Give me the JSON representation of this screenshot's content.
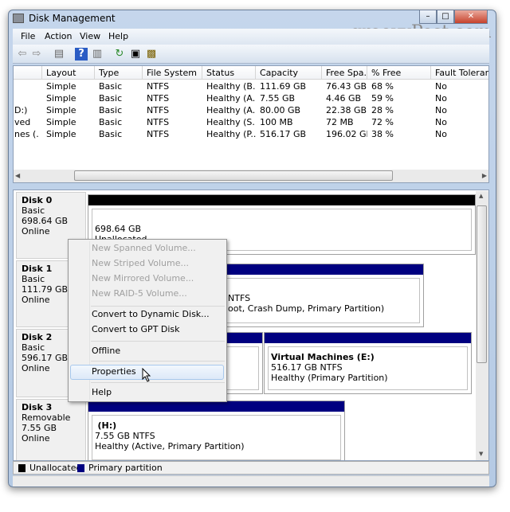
{
  "window": {
    "title": "Disk Management",
    "watermark": "groovyPost.com"
  },
  "menu": [
    "File",
    "Action",
    "View",
    "Help"
  ],
  "toolbar": [
    "back-icon",
    "forward-icon",
    "show-hide-console-tree-icon",
    "help-icon",
    "show-hide-action-pane-icon",
    "refresh-icon",
    "properties-icon",
    "rescan-icon"
  ],
  "columns": [
    "",
    "Layout",
    "Type",
    "File System",
    "Status",
    "Capacity",
    "Free Spa...",
    "% Free",
    "Fault Toleranc"
  ],
  "rows": [
    [
      "",
      "Simple",
      "Basic",
      "NTFS",
      "Healthy (B...",
      "111.69 GB",
      "76.43 GB",
      "68 %",
      "No"
    ],
    [
      "",
      "Simple",
      "Basic",
      "NTFS",
      "Healthy (A...",
      "7.55 GB",
      "4.46 GB",
      "59 %",
      "No"
    ],
    [
      "D:)",
      "Simple",
      "Basic",
      "NTFS",
      "Healthy (A...",
      "80.00 GB",
      "22.38 GB",
      "28 %",
      "No"
    ],
    [
      "ved",
      "Simple",
      "Basic",
      "NTFS",
      "Healthy (S...",
      "100 MB",
      "72 MB",
      "72 %",
      "No"
    ],
    [
      "nes (...",
      "Simple",
      "Basic",
      "NTFS",
      "Healthy (P...",
      "516.17 GB",
      "196.02 GB",
      "38 %",
      "No"
    ]
  ],
  "disks": [
    {
      "name": "Disk 0",
      "type": "Basic",
      "size": "698.64 GB",
      "state": "Online",
      "partitions": [
        {
          "title": "",
          "line1": "698.64 GB",
          "line2": "Unallocated"
        }
      ]
    },
    {
      "name": "Disk 1",
      "type": "Basic",
      "size": "111.79 GB",
      "state": "Online",
      "partitions": [
        {
          "line1": "NTFS",
          "line2": "oot, Crash Dump, Primary Partition)"
        }
      ]
    },
    {
      "name": "Disk 2",
      "type": "Basic",
      "size": "596.17 GB",
      "state": "Online",
      "partitions": [
        {
          "title": "Virtual Machines  (E:)",
          "line1": "516.17 GB NTFS",
          "line2": "Healthy (Primary Partition)"
        }
      ]
    },
    {
      "name": "Disk 3",
      "type": "Removable",
      "size": "7.55 GB",
      "state": "Online",
      "partitions": [
        {
          "title": "(H:)",
          "line1": "7.55 GB NTFS",
          "line2": "Healthy (Active, Primary Partition)"
        }
      ]
    }
  ],
  "legend": [
    {
      "label": "Unallocated",
      "color": "#000000"
    },
    {
      "label": "Primary partition",
      "color": "#000080"
    }
  ],
  "context_menu": {
    "disabled": [
      "New Spanned Volume...",
      "New Striped Volume...",
      "New Mirrored Volume...",
      "New RAID-5 Volume..."
    ],
    "items": [
      "Convert to Dynamic Disk...",
      "Convert to GPT Disk",
      "Offline",
      "Properties",
      "Help"
    ],
    "highlighted": "Properties"
  }
}
